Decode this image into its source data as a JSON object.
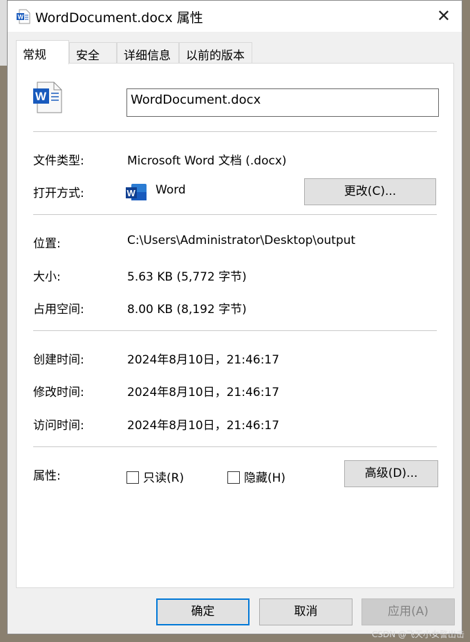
{
  "window": {
    "title": "WordDocument.docx 属性",
    "close_icon": "close-icon"
  },
  "tabs": [
    {
      "label": "常规",
      "active": true
    },
    {
      "label": "安全"
    },
    {
      "label": "详细信息"
    },
    {
      "label": "以前的版本"
    }
  ],
  "general": {
    "file_name": "WordDocument.docx",
    "type_label": "文件类型:",
    "type_value": "Microsoft Word 文档 (.docx)",
    "open_with_label": "打开方式:",
    "open_with_value": "Word",
    "change_button": "更改(C)...",
    "location_label": "位置:",
    "location_value": "C:\\Users\\Administrator\\Desktop\\output",
    "size_label": "大小:",
    "size_value": "5.63 KB (5,772 字节)",
    "disk_size_label": "占用空间:",
    "disk_size_value": "8.00 KB (8,192 字节)",
    "created_label": "创建时间:",
    "created_value": "2024年8月10日，21:46:17",
    "modified_label": "修改时间:",
    "modified_value": "2024年8月10日，21:46:17",
    "accessed_label": "访问时间:",
    "accessed_value": "2024年8月10日，21:46:17",
    "attributes_label": "属性:",
    "readonly_label": "只读(R)",
    "readonly_checked": false,
    "hidden_label": "隐藏(H)",
    "hidden_checked": false,
    "advanced_button": "高级(D)..."
  },
  "footer": {
    "ok": "确定",
    "cancel": "取消",
    "apply": "应用(A)",
    "apply_enabled": false
  },
  "watermark": "CSDN @飞天小女警出击",
  "colors": {
    "word_blue": "#185abd",
    "focus_blue": "#0078d7"
  }
}
